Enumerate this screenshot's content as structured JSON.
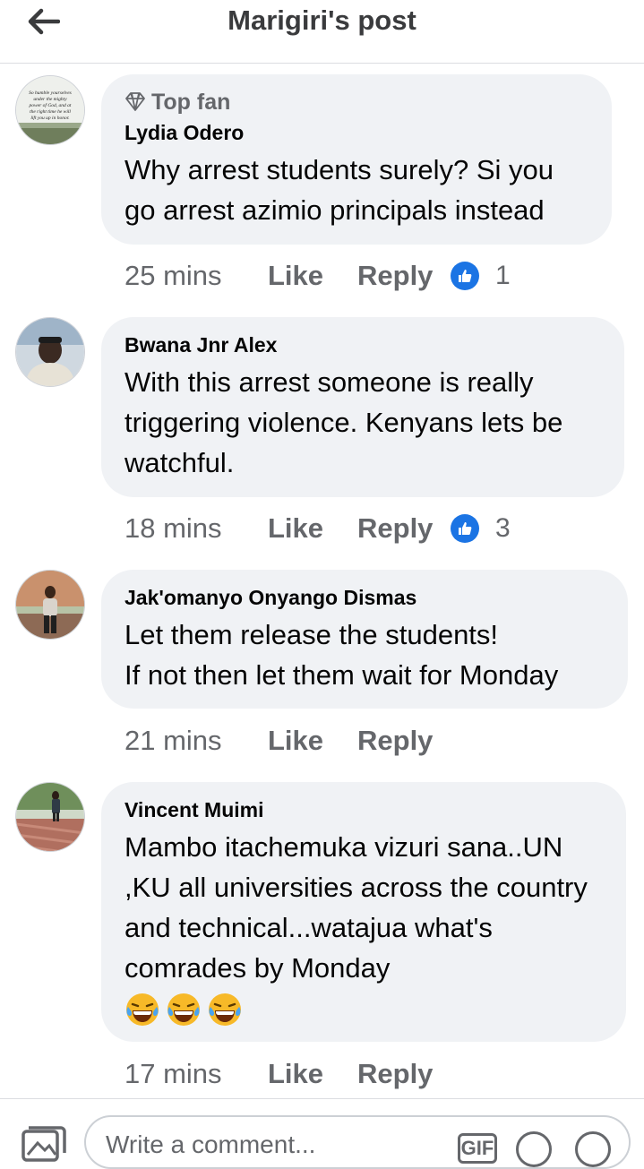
{
  "header": {
    "title": "Marigiri's post",
    "back_icon": "arrow-left-icon"
  },
  "comments": [
    {
      "badge": "Top fan",
      "author": "Lydia Odero",
      "text": "Why arrest students surely? Si you go arrest azimio principals instead",
      "time": "25 mins",
      "like_label": "Like",
      "reply_label": "Reply",
      "reaction_count": "1",
      "avatar_text": "So humble yourselves under the mighty power of God, and at the right time he will lift you up in honor."
    },
    {
      "author": "Bwana Jnr Alex",
      "text": "With this arrest someone is really triggering violence. Kenyans lets be watchful.",
      "time": "18 mins",
      "like_label": "Like",
      "reply_label": "Reply",
      "reaction_count": "3"
    },
    {
      "author": "Jak'omanyo Onyango Dismas",
      "text": "Let them release the students!\nIf not then let them wait for Monday",
      "time": "21 mins",
      "like_label": "Like",
      "reply_label": "Reply"
    },
    {
      "author": "Vincent Muimi",
      "text": "Mambo itachemuka vizuri sana..UN ,KU all universities across the country and technical...watajua what's comrades by Monday",
      "emojis": "😂😂😂",
      "time": "17 mins",
      "like_label": "Like",
      "reply_label": "Reply"
    }
  ],
  "composer": {
    "placeholder": "Write a comment...",
    "gif_label": "GIF",
    "icons": [
      "photo-icon",
      "sticker-icon",
      "emoji-icon"
    ]
  },
  "colors": {
    "bubble": "#f0f2f5",
    "secondary_text": "#65676b",
    "like_blue": "#1b74e4",
    "divider": "#dcdde1"
  }
}
